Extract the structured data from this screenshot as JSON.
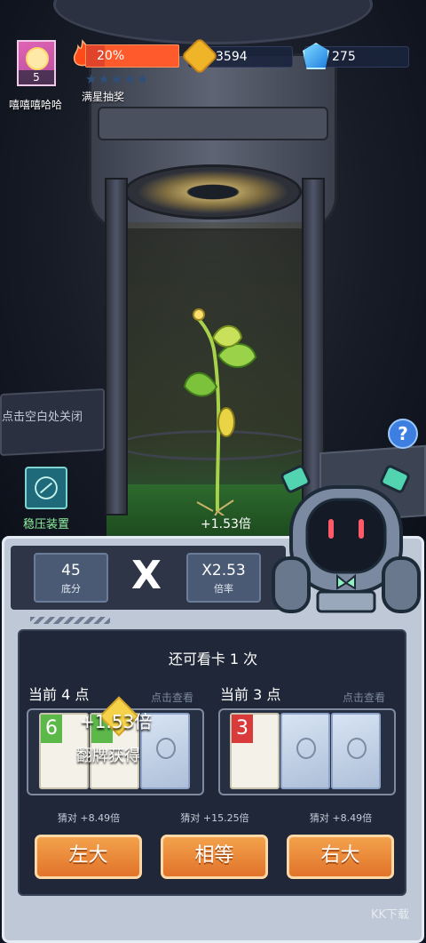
{
  "player": {
    "name": "嘻嘻嘻哈哈",
    "level": "5"
  },
  "energy": {
    "percent_label": "20%",
    "fill_fraction": 0.2,
    "stars_total": 5,
    "stars_filled": 0,
    "label": "满星抽奖"
  },
  "currencies": {
    "coins": "3594",
    "gems": "275"
  },
  "scene": {
    "close_tip": "点击空白处关闭",
    "stabilizer_label": "稳压装置",
    "multiplier_bonus": "+1.53倍"
  },
  "score": {
    "base_value": "45",
    "base_label": "底分",
    "times_sign": "X",
    "rate_value": "X2.53",
    "rate_label": "倍率"
  },
  "game": {
    "remaining_text": "还可看卡 1 次",
    "left": {
      "points_label": "当前 4 点",
      "tap_view": "点击查看",
      "card_ranks": [
        "6",
        "",
        ""
      ]
    },
    "right": {
      "points_label": "当前 3 点",
      "tap_view": "点击查看",
      "card_ranks": [
        "3",
        "",
        ""
      ]
    },
    "flip_bonus": "+1.53倍",
    "flip_gain": "翻牌获得",
    "odds": [
      "猜对 +8.49倍",
      "猜对 +15.25倍",
      "猜对 +8.49倍"
    ],
    "buttons": {
      "left": "左大",
      "equal": "相等",
      "right": "右大"
    }
  },
  "colors": {
    "accent_orange": "#e1732a",
    "panel": "#1f2738",
    "card_green": "#5db84a",
    "card_red": "#d93b3b"
  },
  "watermark": "KK下载"
}
